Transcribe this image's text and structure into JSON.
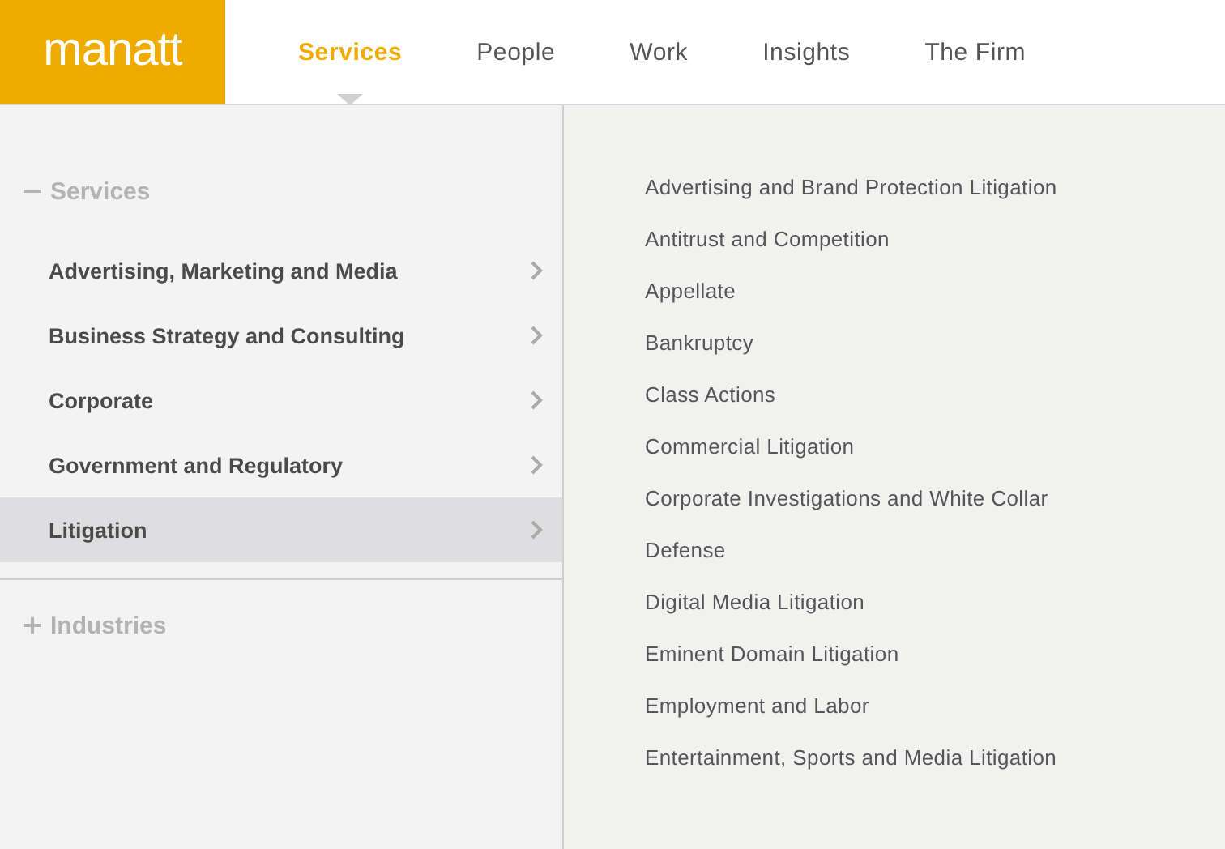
{
  "logo": "manatt",
  "nav": [
    {
      "label": "Services",
      "selected": true
    },
    {
      "label": "People",
      "selected": false
    },
    {
      "label": "Work",
      "selected": false
    },
    {
      "label": "Insights",
      "selected": false
    },
    {
      "label": "The Firm",
      "selected": false
    }
  ],
  "menu": {
    "sections": [
      {
        "label": "Services",
        "expanded": true,
        "items": [
          {
            "label": "Advertising, Marketing and Media",
            "selected": false
          },
          {
            "label": "Business Strategy and Consulting",
            "selected": false
          },
          {
            "label": "Corporate",
            "selected": false
          },
          {
            "label": "Government and Regulatory",
            "selected": false
          },
          {
            "label": "Litigation",
            "selected": true
          }
        ]
      },
      {
        "label": "Industries",
        "expanded": false
      }
    ],
    "subitems": [
      "Advertising and Brand Protection Litigation",
      "Antitrust and Competition",
      "Appellate",
      "Bankruptcy",
      "Class Actions",
      "Commercial Litigation",
      "Corporate Investigations and White Collar",
      "Defense",
      "Digital Media Litigation",
      "Eminent Domain Litigation",
      "Employment and Labor",
      "Entertainment, Sports and Media Litigation"
    ]
  }
}
